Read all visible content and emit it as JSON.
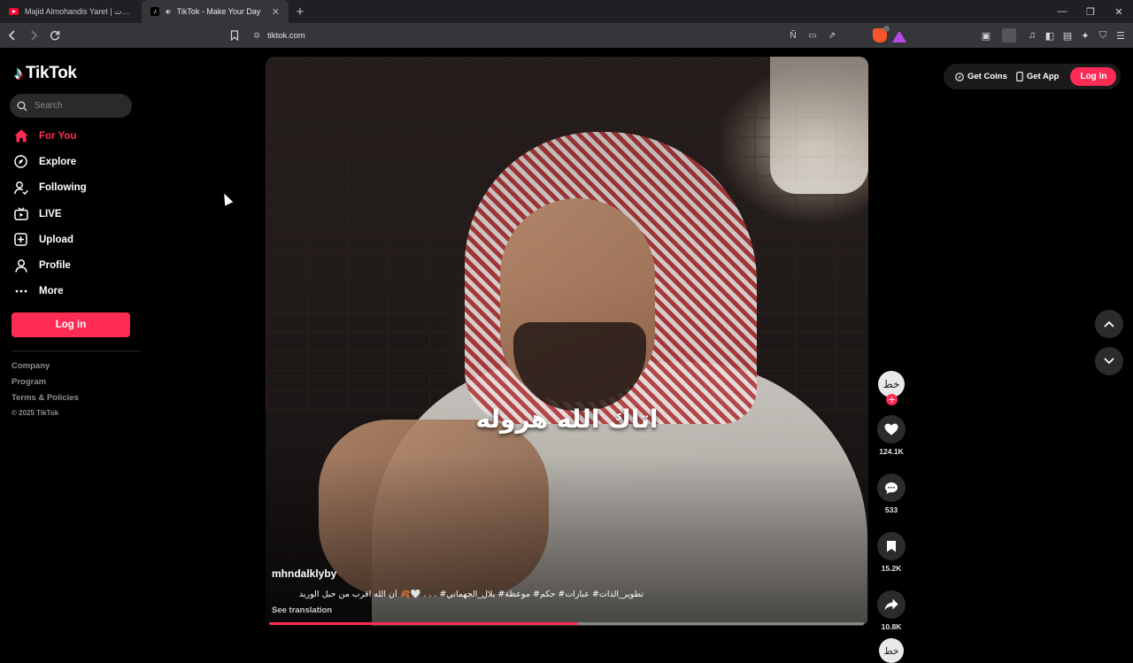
{
  "browser": {
    "tabs": [
      {
        "title": "Majid Almohandis Yaret | بندس يارت",
        "active": false
      },
      {
        "title": "TikTok - Make Your Day",
        "active": true
      }
    ],
    "url": "tiktok.com",
    "shield_badge": "",
    "rewards_badge": "1"
  },
  "brand": {
    "logo_text": "TikTok",
    "accent_color": "#fe2c55"
  },
  "search": {
    "placeholder": "Search"
  },
  "nav": {
    "items": [
      {
        "label": "For You",
        "icon": "home-icon",
        "active": true
      },
      {
        "label": "Explore",
        "icon": "compass-icon",
        "active": false
      },
      {
        "label": "Following",
        "icon": "following-icon",
        "active": false
      },
      {
        "label": "LIVE",
        "icon": "live-icon",
        "active": false
      },
      {
        "label": "Upload",
        "icon": "upload-icon",
        "active": false
      },
      {
        "label": "Profile",
        "icon": "profile-icon",
        "active": false
      },
      {
        "label": "More",
        "icon": "more-icon",
        "active": false
      }
    ]
  },
  "sidebar": {
    "login_label": "Log in",
    "footer_links": [
      "Company",
      "Program",
      "Terms & Policies"
    ],
    "copyright": "© 2025 TikTok"
  },
  "topbar": {
    "get_coins": "Get Coins",
    "get_app": "Get App",
    "login_label": "Log in"
  },
  "video": {
    "overlay_text": "اتاك الله هروله",
    "author": "mhndalklyby",
    "caption": "تطوير_الذات# عبارات# حكم# موعظة# بلال_الجهماني# . . . 🤍🍂 أن الله اقرب من حبل الوريد",
    "see_translation": "See translation",
    "progress": 0.52
  },
  "actions": {
    "likes": "124.1K",
    "comments": "533",
    "saves": "15.2K",
    "shares": "10.8K"
  }
}
